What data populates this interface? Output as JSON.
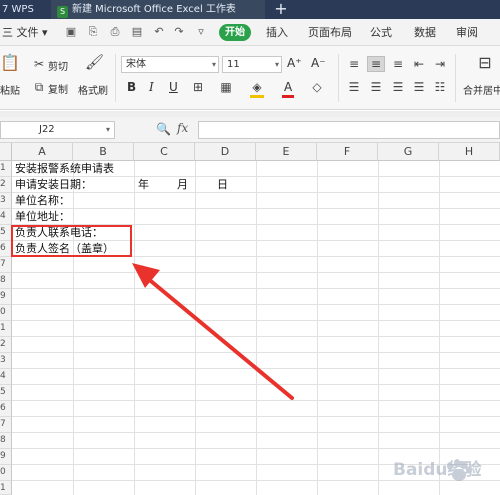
{
  "tabs": {
    "wps_label": "7 WPS",
    "doc_icon": "S",
    "doc_title": "新建 Microsoft Office Excel 工作表",
    "add": "+"
  },
  "menu": {
    "file": "三 文件 ▾",
    "start": "开始",
    "insert": "插入",
    "layout": "页面布局",
    "formula": "公式",
    "data": "数据",
    "review": "审阅"
  },
  "ribbon": {
    "paste": "粘贴",
    "cut": "剪切",
    "copy": "复制",
    "format_painter": "格式刷",
    "font_name": "宋体",
    "font_size": "11",
    "bold": "B",
    "italic": "I",
    "underline": "U",
    "grow_font": "A⁺",
    "shrink_font": "A⁻",
    "font_color_letter": "A",
    "merge_center": "合并居中"
  },
  "formula_bar": {
    "cell_ref": "J22",
    "fx": "fx",
    "value": ""
  },
  "columns": [
    "A",
    "B",
    "C",
    "D",
    "E",
    "F",
    "G",
    "H"
  ],
  "rows": [
    "1",
    "2",
    "3",
    "4",
    "5",
    "6",
    "7",
    "8",
    "9",
    "0",
    "1",
    "2",
    "3",
    "4",
    "5",
    "6",
    "7",
    "8",
    "9",
    "0",
    "1"
  ],
  "cells": {
    "a1": "安装报警系统申请表",
    "a2": "申请安装日期：",
    "c2": "年",
    "c2b": "月",
    "d2": "日",
    "a3": "单位名称：",
    "a4": "单位地址：",
    "a5": "负责人联系电话：",
    "a6": "负责人签名（盖章）"
  },
  "annotation": {
    "color": "#e8322b"
  },
  "watermark": "Baidu经验"
}
